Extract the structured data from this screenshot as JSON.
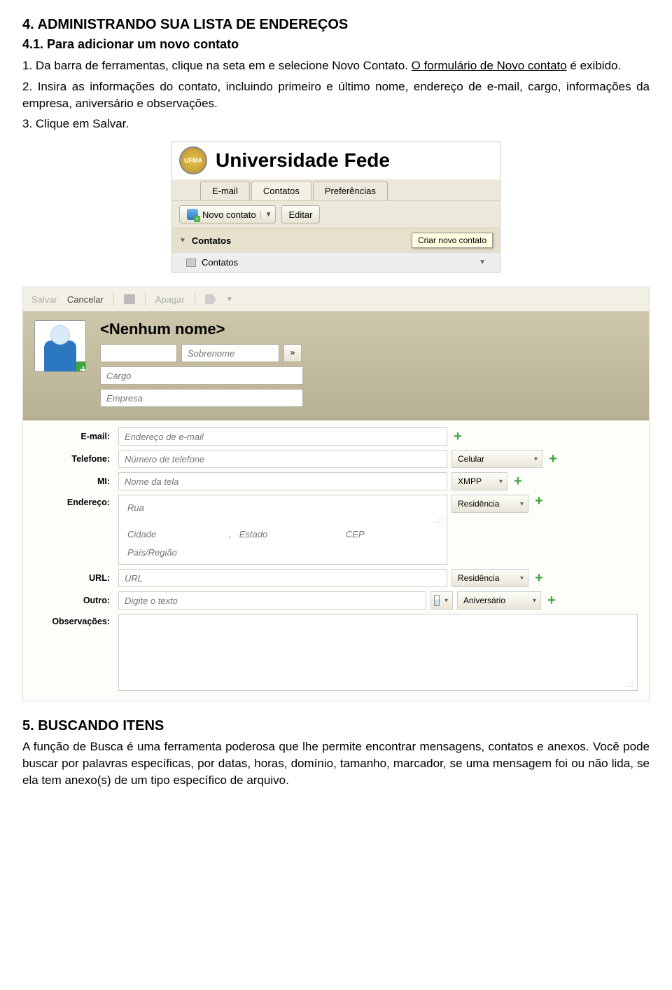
{
  "doc": {
    "section4_title": "4. ADMINISTRANDO SUA LISTA DE ENDEREÇOS",
    "section41_title": "4.1. Para adicionar um novo contato",
    "para1_a": "1. Da barra de ferramentas, clique na seta em e selecione Novo Contato. ",
    "para1_link": "O formulário de Novo contato",
    "para1_b": " é exibido.",
    "para2": "2. Insira as informações do contato, incluindo primeiro e último nome, endereço de e-mail, cargo, informações da empresa, aniversário e observações.",
    "para3": "3. Clique em Salvar.",
    "section5_title": "5. BUSCANDO ITENS",
    "para5": "A função de Busca é uma ferramenta poderosa que lhe permite encontrar mensagens, contatos e anexos. Você pode buscar por palavras específicas, por datas, horas, domínio, tamanho, marcador, se uma mensagem foi ou não lida, se ela tem anexo(s) de um tipo específico de arquivo."
  },
  "shot1": {
    "badge": "UFMA",
    "app_title": "Universidade Fede",
    "tabs": {
      "email": "E-mail",
      "contacts": "Contatos",
      "prefs": "Preferências"
    },
    "new_contact": "Novo contato",
    "edit": "Editar",
    "folder_header": "Contatos",
    "tooltip": "Criar novo contato",
    "subfolder": "Contatos"
  },
  "shot2": {
    "tb": {
      "save": "Salvar",
      "cancel": "Cancelar",
      "delete": "Apagar"
    },
    "noname": "<Nenhum nome>",
    "first_ph": "",
    "last_ph": "Sobrenome",
    "cargo_ph": "Cargo",
    "empresa_ph": "Empresa",
    "labels": {
      "email": "E-mail:",
      "phone": "Telefone:",
      "mi": "MI:",
      "addr": "Endereço:",
      "url": "URL:",
      "other": "Outro:",
      "notes": "Observações:"
    },
    "ph": {
      "email": "Endereço de e-mail",
      "phone": "Número de telefone",
      "mi": "Nome da tela",
      "street": "Rua",
      "city": "Cidade",
      "state": "Estado",
      "zip": "CEP",
      "country": "País/Região",
      "url": "URL",
      "other": "Digite o texto"
    },
    "sel": {
      "celular": "Celular",
      "xmpp": "XMPP",
      "residencia": "Residência",
      "residencia2": "Residência",
      "aniversario": "Aniversário"
    },
    "comma": ","
  }
}
